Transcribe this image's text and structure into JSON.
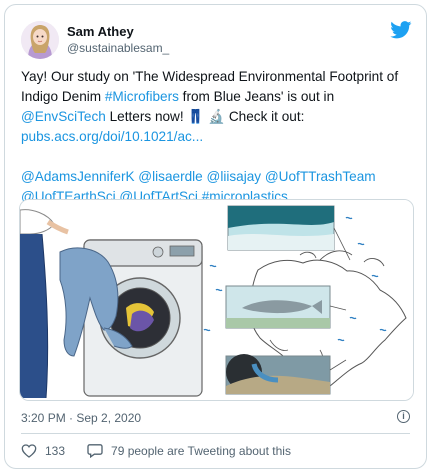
{
  "author": {
    "name": "Sam Athey",
    "handle": "@sustainablesam_"
  },
  "tweet": {
    "line1": "Yay! Our study on 'The Widespread Environmental Footprint of",
    "line2_pre": "Indigo Denim ",
    "line2_hashtag": "#Microfibers",
    "line2_post": " from Blue Jeans' is out in",
    "line3_mention": "@EnvSciTech",
    "line3_post": " Letters now! 👖 🔬 Check it out:",
    "line4_link": "pubs.acs.org/doi/10.1021/ac...",
    "mentions_line1": "@AdamsJenniferK @lisaerdle @liisajay @UofTTrashTeam",
    "mentions_line2": "@UofTEarthSci @UofTArtSci #microplastics"
  },
  "meta": {
    "timestamp": "3:20 PM · Sep 2, 2020",
    "info_label": "i"
  },
  "actions": {
    "like_count": "133",
    "retweet_text": "79 people are Tweeting about this"
  },
  "colors": {
    "link": "#1b95e0",
    "twitter_blue": "#1da1f2",
    "heart": "#536471"
  }
}
